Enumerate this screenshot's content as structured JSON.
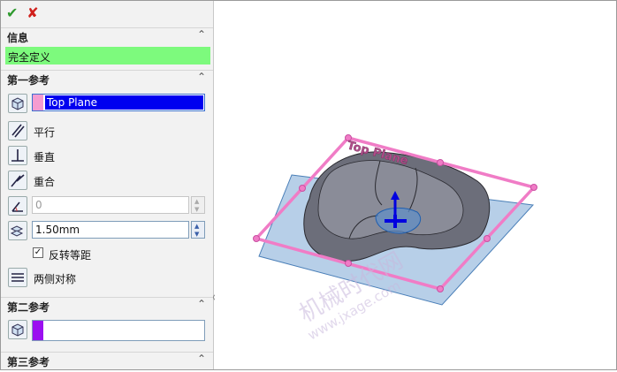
{
  "panel": {
    "ok_icon": "✔",
    "cancel_icon": "✘",
    "info": {
      "title": "信息",
      "status": "完全定义"
    },
    "ref1": {
      "title": "第一参考",
      "selection": "Top Plane",
      "options": {
        "parallel": "平行",
        "perpendicular": "垂直",
        "coincident": "重合"
      },
      "angle_value": "0",
      "distance_value": "1.50mm",
      "flip_label": "反转等距",
      "flip_checked": "✓",
      "symmetric_label": "两侧对称"
    },
    "ref2": {
      "title": "第二参考"
    },
    "ref3": {
      "title": "第三参考"
    },
    "chevron": "⌃"
  },
  "viewport": {
    "plane_label": "Top Plane",
    "watermark_cn": "机械时代网",
    "watermark_url": "www.jxage.com"
  },
  "colors": {
    "plane_pink": "#f07cc6",
    "plane_blue": "#7ca9d8",
    "status_green": "#7dfa7d",
    "selection_blue": "#0000f0"
  }
}
